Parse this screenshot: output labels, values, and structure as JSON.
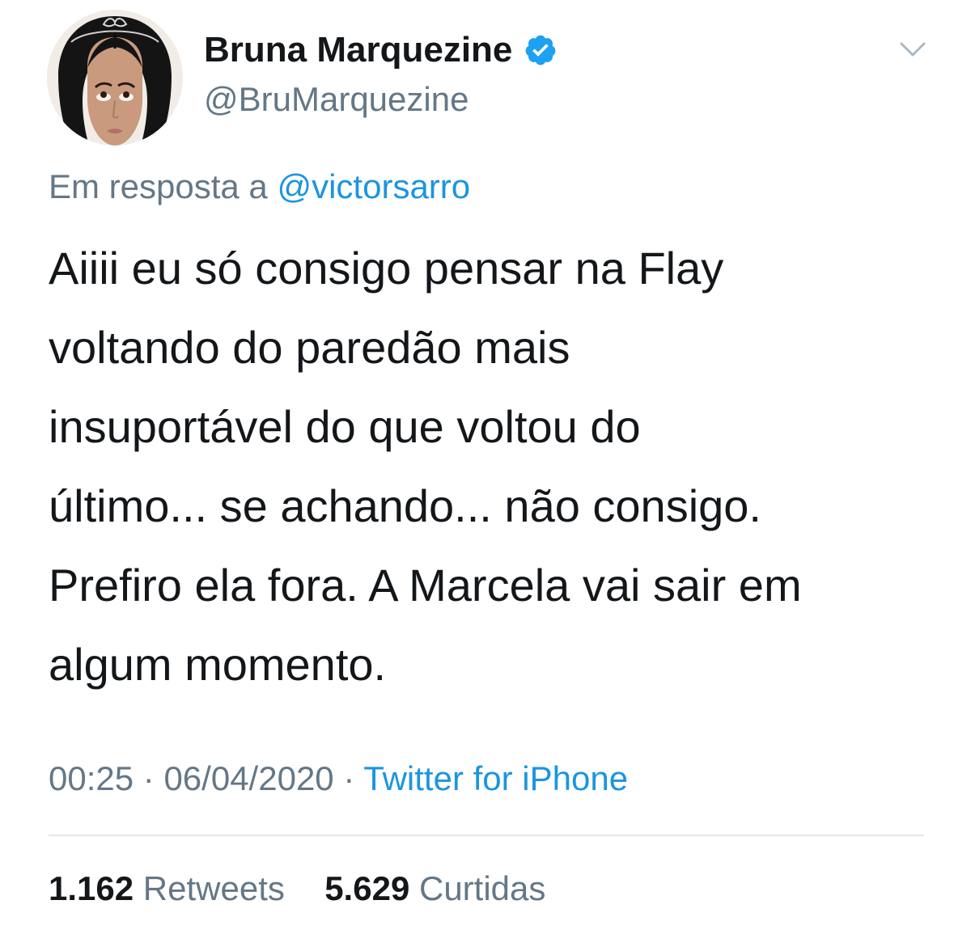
{
  "header": {
    "display_name": "Bruna Marquezine",
    "handle": "@BruMarquezine",
    "verified_icon": "verified-badge-icon",
    "menu_icon": "chevron-down-icon",
    "accent_color": "#1da1f2"
  },
  "reply": {
    "prefix": "Em resposta a",
    "mention": "@victorsarro"
  },
  "tweet": {
    "lines": [
      "Aiiii eu só consigo pensar na Flay",
      "voltando do paredão mais",
      "insuportável do que voltou do",
      "último... se achando... não consigo.",
      "Prefiro ela fora. A Marcela vai sair em",
      "algum momento."
    ]
  },
  "meta": {
    "time": "00:25",
    "date": "06/04/2020",
    "separator": "·",
    "source": "Twitter for iPhone"
  },
  "stats": {
    "retweets_count": "1.162",
    "retweets_label": "Retweets",
    "likes_count": "5.629",
    "likes_label": "Curtidas"
  }
}
